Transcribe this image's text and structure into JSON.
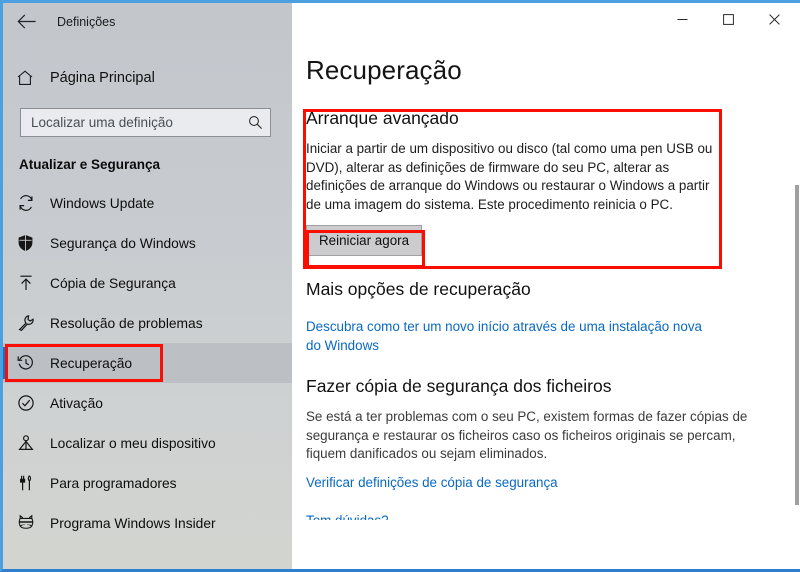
{
  "window": {
    "app_title": "Definições",
    "back_icon": "back-arrow-icon",
    "minimize_label": "─",
    "maximize_label": "□",
    "close_label": "✕",
    "accent_color": "#0078d7",
    "annotation_color": "#fb0d00",
    "titlebar_color": "#c3c7cc",
    "link_color": "#0969c3"
  },
  "sidebar": {
    "home": {
      "label": "Página Principal",
      "icon": "home-icon"
    },
    "search": {
      "placeholder": "Localizar uma definição",
      "value": "",
      "icon": "search-icon"
    },
    "heading": "Atualizar e Segurança",
    "items": [
      {
        "label": "Windows Update",
        "icon": "refresh-icon",
        "selected": false
      },
      {
        "label": "Segurança do Windows",
        "icon": "shield-icon",
        "selected": false
      },
      {
        "label": "Cópia de Segurança",
        "icon": "upload-arrow-icon",
        "selected": false
      },
      {
        "label": "Resolução de problemas",
        "icon": "wrench-icon",
        "selected": false
      },
      {
        "label": "Recuperação",
        "icon": "clock-history-icon",
        "selected": true
      },
      {
        "label": "Ativação",
        "icon": "check-circle-icon",
        "selected": false
      },
      {
        "label": "Localizar o meu dispositivo",
        "icon": "find-device-icon",
        "selected": false
      },
      {
        "label": "Para programadores",
        "icon": "tools-icon",
        "selected": false
      },
      {
        "label": "Programa Windows Insider",
        "icon": "ninjacat-icon",
        "selected": false
      }
    ]
  },
  "main": {
    "page_title": "Recuperação",
    "advanced_startup": {
      "heading": "Arranque avançado",
      "body": "Iniciar a partir de um dispositivo ou disco (tal como uma pen USB ou DVD), alterar as definições de firmware do seu PC, alterar as definições de arranque do Windows ou restaurar o Windows a partir de uma imagem do sistema. Este procedimento reinicia o PC.",
      "button_label": "Reiniciar agora"
    },
    "more_options": {
      "heading": "Mais opções de recuperação",
      "link": "Descubra como ter um novo início através de uma instalação nova do Windows"
    },
    "backup_files": {
      "heading": "Fazer cópia de segurança dos ficheiros",
      "body": "Se está a ter problemas com o seu PC, existem formas de fazer cópias de segurança e restaurar os ficheiros caso os ficheiros originais se percam, fiquem danificados ou sejam eliminados.",
      "link": "Verificar definições de cópia de segurança"
    },
    "cut_off_heading": "Tem dúvidas?"
  }
}
